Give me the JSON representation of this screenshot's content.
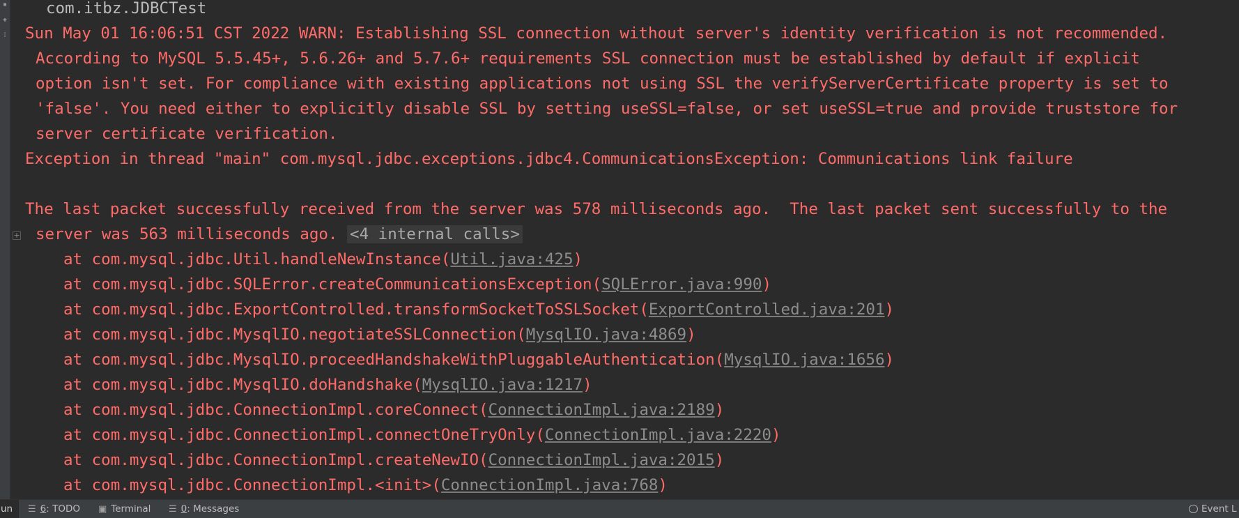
{
  "console": {
    "command": "com.itbz.JDBCTest",
    "warn_lines": [
      "Sun May 01 16:06:51 CST 2022 WARN: Establishing SSL connection without server's identity verification is not recommended.",
      "According to MySQL 5.5.45+, 5.6.26+ and 5.7.6+ requirements SSL connection must be established by default if explicit",
      "option isn't set. For compliance with existing applications not using SSL the verifyServerCertificate property is set to",
      "'false'. You need either to explicitly disable SSL by setting useSSL=false, or set useSSL=true and provide truststore for",
      "server certificate verification."
    ],
    "exception_line": "Exception in thread \"main\" com.mysql.jdbc.exceptions.jdbc4.CommunicationsException: Communications link failure",
    "packet_line_1": "The last packet successfully received from the server was 578 milliseconds ago.  The last packet sent successfully to the",
    "packet_line_2": "server was 563 milliseconds ago.",
    "internal_calls": "<4 internal calls>",
    "stack_frames": [
      {
        "prefix": "at com.mysql.jdbc.Util.handleNewInstance",
        "location": "Util.java:425"
      },
      {
        "prefix": "at com.mysql.jdbc.SQLError.createCommunicationsException",
        "location": "SQLError.java:990"
      },
      {
        "prefix": "at com.mysql.jdbc.ExportControlled.transformSocketToSSLSocket",
        "location": "ExportControlled.java:201"
      },
      {
        "prefix": "at com.mysql.jdbc.MysqlIO.negotiateSSLConnection",
        "location": "MysqlIO.java:4869"
      },
      {
        "prefix": "at com.mysql.jdbc.MysqlIO.proceedHandshakeWithPluggableAuthentication",
        "location": "MysqlIO.java:1656"
      },
      {
        "prefix": "at com.mysql.jdbc.MysqlIO.doHandshake",
        "location": "MysqlIO.java:1217"
      },
      {
        "prefix": "at com.mysql.jdbc.ConnectionImpl.coreConnect",
        "location": "ConnectionImpl.java:2189"
      },
      {
        "prefix": "at com.mysql.jdbc.ConnectionImpl.connectOneTryOnly",
        "location": "ConnectionImpl.java:2220"
      },
      {
        "prefix": "at com.mysql.jdbc.ConnectionImpl.createNewIO",
        "location": "ConnectionImpl.java:2015"
      },
      {
        "prefix": "at com.mysql.jdbc.ConnectionImpl.<init>",
        "location": "ConnectionImpl.java:768"
      }
    ],
    "paren_open": "(",
    "paren_close": ")"
  },
  "toolbar": {
    "run_label": "un",
    "todo_key": "6",
    "todo_label": ": TODO",
    "terminal_label": "Terminal",
    "messages_key": "0",
    "messages_label": ": Messages",
    "event_log_label": "Event L"
  },
  "icons": {
    "todo": "list-icon",
    "terminal": "terminal-icon",
    "messages": "messages-icon",
    "event_log": "bubble-icon",
    "fold": "expand-fold-icon"
  },
  "colors": {
    "background": "#2b2b2b",
    "error_text": "#ff6b68",
    "command_text": "#bbbbbb",
    "link_text": "#8c8c8c",
    "toolbar_bg": "#3c3f41"
  }
}
